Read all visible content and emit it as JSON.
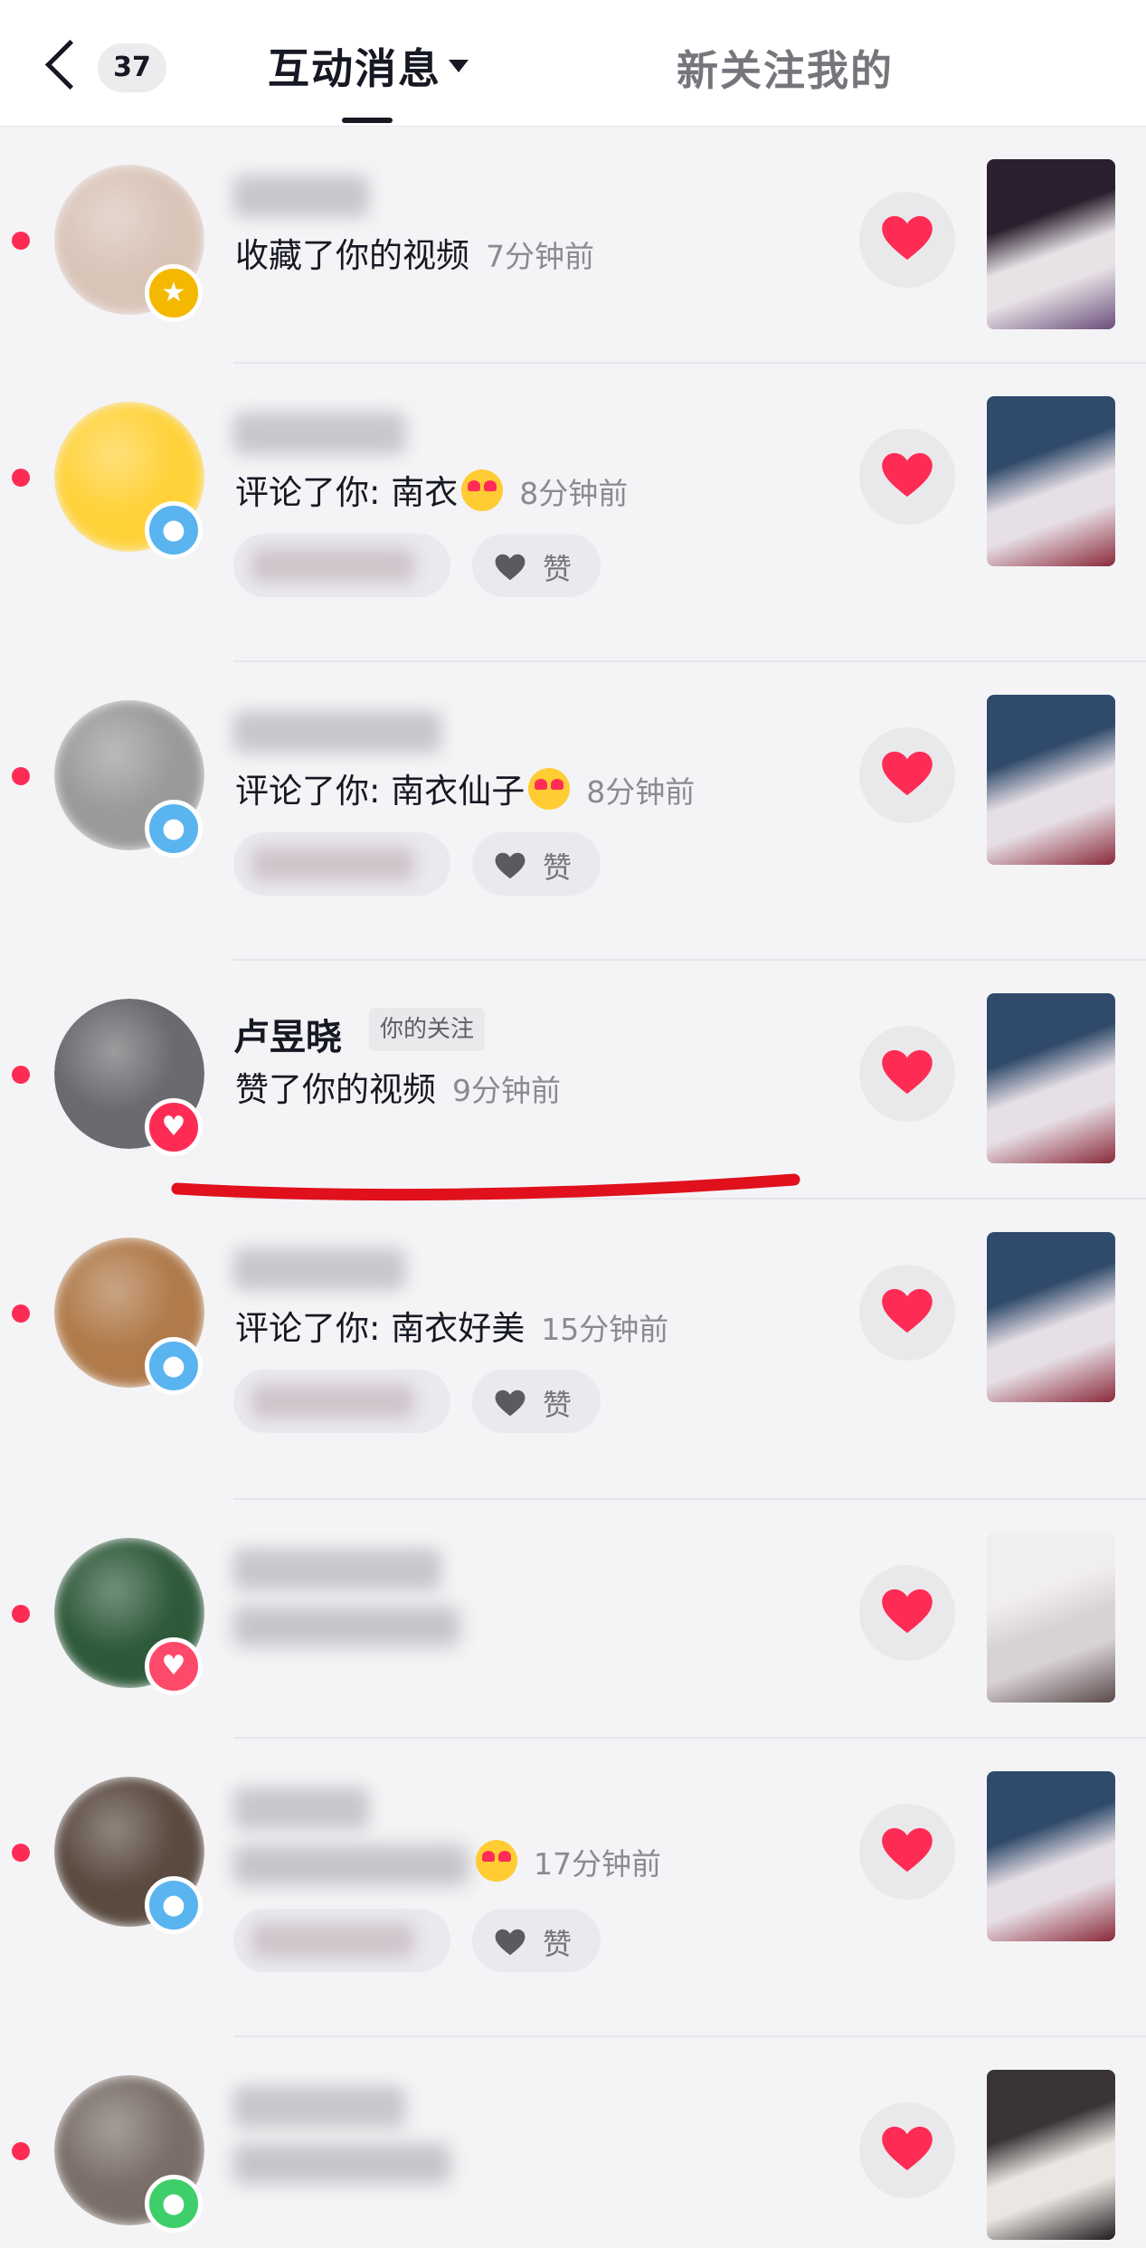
{
  "header": {
    "unread_count": "37",
    "tab_active": "互动消息",
    "tab_other": "新关注我的"
  },
  "rows": [
    {
      "name": "",
      "name_blurred": true,
      "action": "收藏了你的视频",
      "action_blurred": false,
      "emoji": false,
      "time": "7分钟前",
      "has_pills": false,
      "avatar_color": "#d9c4b8",
      "badge_color": "#f5b800",
      "badge_icon": "★",
      "thumb_colors": [
        "#2a1f2e",
        "#e8e2e6",
        "#6a4f7a"
      ]
    },
    {
      "name": "",
      "name_blurred": true,
      "action": "评论了你: 南衣",
      "action_blurred": false,
      "emoji": true,
      "time": "8分钟前",
      "has_pills": true,
      "like_label": "赞",
      "avatar_color": "#ffd23a",
      "badge_color": "#5ab4f0",
      "badge_icon": "●",
      "thumb_colors": [
        "#2f4a6a",
        "#e7dfe6",
        "#8a2a3a"
      ]
    },
    {
      "name": "",
      "name_blurred": true,
      "action": "评论了你: 南衣仙子",
      "action_blurred": false,
      "emoji": true,
      "time": "8分钟前",
      "has_pills": true,
      "like_label": "赞",
      "avatar_color": "#9a9a9a",
      "badge_color": "#5ab4f0",
      "badge_icon": "●",
      "thumb_colors": [
        "#2f4a6a",
        "#e7dfe6",
        "#8a2a3a"
      ]
    },
    {
      "name": "卢昱晓",
      "name_blurred": false,
      "follow_tag": "你的关注",
      "action": "赞了你的视频",
      "action_blurred": false,
      "emoji": false,
      "time": "9分钟前",
      "has_pills": false,
      "avatar_color": "#6b6a6e",
      "badge_color": "#fe2c55",
      "badge_icon": "♥",
      "thumb_colors": [
        "#2f4a6a",
        "#e7dfe6",
        "#8a2a3a"
      ]
    },
    {
      "name": "",
      "name_blurred": true,
      "action": "评论了你: 南衣好美",
      "action_blurred": false,
      "emoji": false,
      "time": "15分钟前",
      "has_pills": true,
      "like_label": "赞",
      "avatar_color": "#b07a4a",
      "badge_color": "#5ab4f0",
      "badge_icon": "●",
      "thumb_colors": [
        "#2f4a6a",
        "#e7dfe6",
        "#8a2a3a"
      ]
    },
    {
      "name": "",
      "name_blurred": true,
      "action": "",
      "action_blurred": true,
      "emoji": false,
      "time": "",
      "has_pills": false,
      "avatar_color": "#2f5a3a",
      "badge_color": "#fe4a6a",
      "badge_icon": "♥",
      "thumb_colors": [
        "#f1eef0",
        "#d8d2d6",
        "#5a4a4a"
      ]
    },
    {
      "name": "",
      "name_blurred": true,
      "action": "",
      "action_blurred": true,
      "emoji": true,
      "time": "17分钟前",
      "has_pills": true,
      "like_label": "赞",
      "avatar_color": "#5a4a40",
      "badge_color": "#5ab4f0",
      "badge_icon": "●",
      "thumb_colors": [
        "#2f4a6a",
        "#e7dfe6",
        "#8a2a3a"
      ]
    },
    {
      "name": "",
      "name_blurred": true,
      "action": "",
      "action_blurred": false,
      "emoji": false,
      "time": "",
      "has_pills": false,
      "avatar_color": "#7a6e68",
      "badge_color": "#3fcf6a",
      "badge_icon": "●",
      "thumb_colors": [
        "#3a3438",
        "#ece6e2",
        "#1e1a1c"
      ]
    }
  ]
}
